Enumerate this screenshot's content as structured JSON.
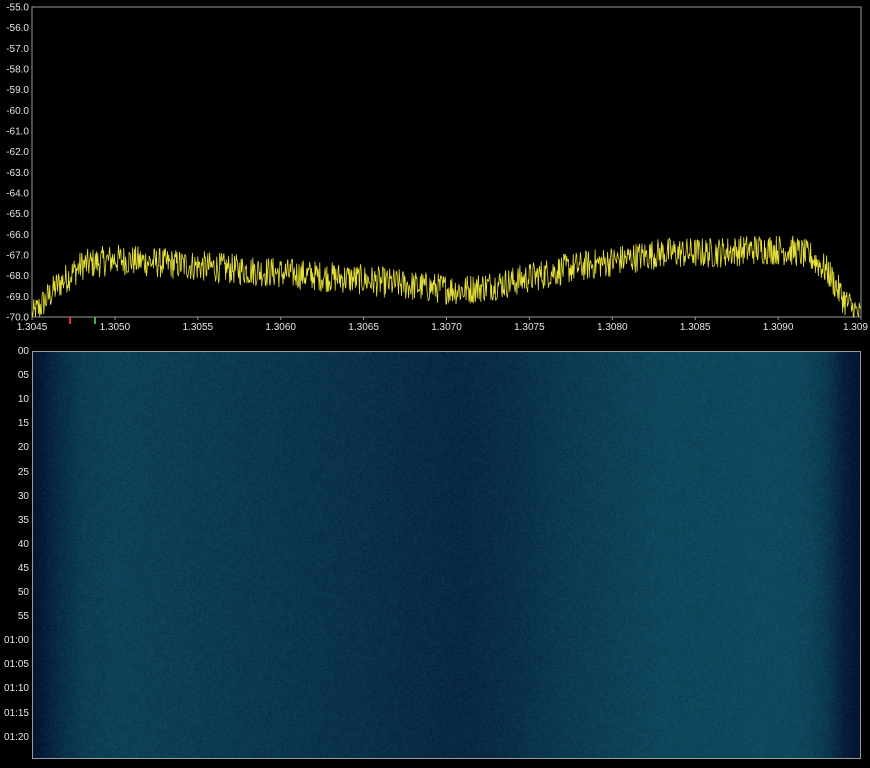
{
  "spectrum": {
    "y_ticks": [
      "-55.0",
      "-56.0",
      "-57.0",
      "-58.0",
      "-59.0",
      "-60.0",
      "-61.0",
      "-62.0",
      "-63.0",
      "-64.0",
      "-65.0",
      "-66.0",
      "-67.0",
      "-68.0",
      "-69.0",
      "-70.0"
    ],
    "x_ticks": [
      "1.3045",
      "1.3050",
      "1.3055",
      "1.3060",
      "1.3065",
      "1.3070",
      "1.3075",
      "1.3080",
      "1.3085",
      "1.3090",
      "1.309"
    ],
    "trace_color": "#e6e03a",
    "marker_colors": [
      "#e23b2b",
      "#3bb34a"
    ]
  },
  "chart_data": {
    "type": "line",
    "title": "",
    "xlabel": "",
    "ylabel": "",
    "xlim": [
      1.3045,
      1.3095
    ],
    "ylim": [
      -70.0,
      -55.0
    ],
    "grid": false,
    "x": [
      1.3045,
      1.30465,
      1.3048,
      1.305,
      1.3053,
      1.3056,
      1.3059,
      1.3062,
      1.3065,
      1.3068,
      1.3071,
      1.3074,
      1.3077,
      1.308,
      1.3083,
      1.3086,
      1.3089,
      1.3091,
      1.3092,
      1.3093,
      1.3094,
      1.3095
    ],
    "series": [
      {
        "values": [
          -70.0,
          -68.5,
          -67.5,
          -67.2,
          -67.4,
          -67.6,
          -67.8,
          -68.0,
          -68.2,
          -68.5,
          -68.7,
          -68.3,
          -67.7,
          -67.3,
          -66.9,
          -66.9,
          -66.7,
          -66.8,
          -67.1,
          -67.8,
          -69.2,
          -70.0
        ]
      }
    ],
    "markers": [
      1.30473,
      1.30488
    ]
  },
  "waterfall": {
    "time_labels": [
      "00",
      "05",
      "10",
      "15",
      "20",
      "25",
      "30",
      "35",
      "40",
      "45",
      "50",
      "55",
      "01:00",
      "01:05",
      "01:10",
      "01:15",
      "01:20"
    ]
  }
}
